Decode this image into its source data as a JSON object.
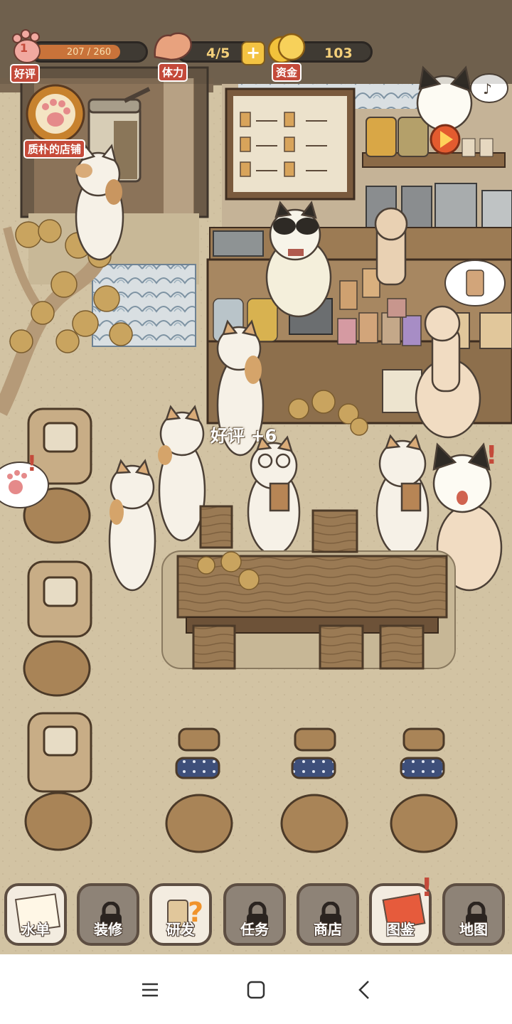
{
  "hud": {
    "rating": {
      "label": "好评",
      "level": "1",
      "value_text": "207 / 260",
      "progress": 0.796
    },
    "stamina": {
      "label": "体力",
      "value_text": "4/5"
    },
    "funds": {
      "label": "资金",
      "value_text": "103"
    }
  },
  "shop": {
    "name": "质朴的店铺"
  },
  "effects": {
    "floating_text": "好评 +6"
  },
  "toolbar": {
    "buttons": [
      {
        "label": "水单",
        "locked": false
      },
      {
        "label": "装修",
        "locked": true
      },
      {
        "label": "研发",
        "locked": false
      },
      {
        "label": "任务",
        "locked": true
      },
      {
        "label": "商店",
        "locked": true
      },
      {
        "label": "图鉴",
        "locked": false,
        "alert": true
      },
      {
        "label": "地图",
        "locked": true
      }
    ]
  },
  "colors": {
    "accent": "#c44a3a",
    "wood": "#8a6a46",
    "floor": "#d2c3a3",
    "gold": "#f4d07a"
  },
  "icons": [
    "paw-icon",
    "muscle-icon",
    "coin-icon",
    "plus-icon",
    "lock-icon",
    "menu-icon",
    "home-icon",
    "back-icon"
  ]
}
